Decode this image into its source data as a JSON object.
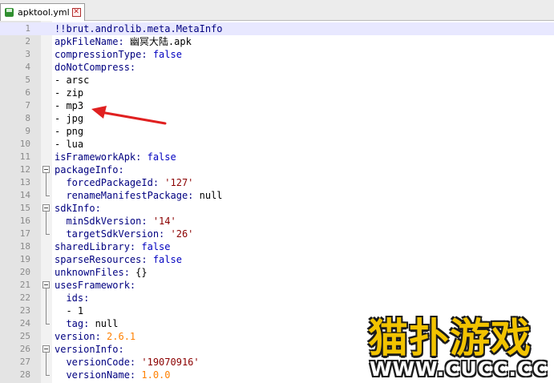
{
  "tab": {
    "filename": "apktool.yml",
    "close_glyph": "✕"
  },
  "lines": [
    {
      "num": "1",
      "tokens": [
        {
          "t": "!!brut.androlib.meta.MetaInfo",
          "c": "k"
        }
      ]
    },
    {
      "num": "2",
      "tokens": [
        {
          "t": "apkFileName: ",
          "c": "k"
        },
        {
          "t": "幽冥大陆.apk",
          "c": ""
        }
      ]
    },
    {
      "num": "3",
      "tokens": [
        {
          "t": "compressionType: ",
          "c": "k"
        },
        {
          "t": "false",
          "c": "v"
        }
      ]
    },
    {
      "num": "4",
      "tokens": [
        {
          "t": "doNotCompress:",
          "c": "k"
        }
      ]
    },
    {
      "num": "5",
      "tokens": [
        {
          "t": "- arsc",
          "c": ""
        }
      ]
    },
    {
      "num": "6",
      "tokens": [
        {
          "t": "- zip",
          "c": ""
        }
      ]
    },
    {
      "num": "7",
      "tokens": [
        {
          "t": "- mp3",
          "c": ""
        }
      ]
    },
    {
      "num": "8",
      "tokens": [
        {
          "t": "- jpg",
          "c": ""
        }
      ]
    },
    {
      "num": "9",
      "tokens": [
        {
          "t": "- png",
          "c": ""
        }
      ]
    },
    {
      "num": "10",
      "tokens": [
        {
          "t": "- lua",
          "c": ""
        }
      ]
    },
    {
      "num": "11",
      "tokens": [
        {
          "t": "isFrameworkApk: ",
          "c": "k"
        },
        {
          "t": "false",
          "c": "v"
        }
      ]
    },
    {
      "num": "12",
      "tokens": [
        {
          "t": "packageInfo:",
          "c": "k"
        }
      ]
    },
    {
      "num": "13",
      "tokens": [
        {
          "t": "  forcedPackageId: ",
          "c": "k"
        },
        {
          "t": "'127'",
          "c": "s"
        }
      ]
    },
    {
      "num": "14",
      "tokens": [
        {
          "t": "  renameManifestPackage: ",
          "c": "k"
        },
        {
          "t": "null",
          "c": ""
        }
      ]
    },
    {
      "num": "15",
      "tokens": [
        {
          "t": "sdkInfo:",
          "c": "k"
        }
      ]
    },
    {
      "num": "16",
      "tokens": [
        {
          "t": "  minSdkVersion: ",
          "c": "k"
        },
        {
          "t": "'14'",
          "c": "s"
        }
      ]
    },
    {
      "num": "17",
      "tokens": [
        {
          "t": "  targetSdkVersion: ",
          "c": "k"
        },
        {
          "t": "'26'",
          "c": "s"
        }
      ]
    },
    {
      "num": "18",
      "tokens": [
        {
          "t": "sharedLibrary: ",
          "c": "k"
        },
        {
          "t": "false",
          "c": "v"
        }
      ]
    },
    {
      "num": "19",
      "tokens": [
        {
          "t": "sparseResources: ",
          "c": "k"
        },
        {
          "t": "false",
          "c": "v"
        }
      ]
    },
    {
      "num": "20",
      "tokens": [
        {
          "t": "unknownFiles: ",
          "c": "k"
        },
        {
          "t": "{}",
          "c": ""
        }
      ]
    },
    {
      "num": "21",
      "tokens": [
        {
          "t": "usesFramework:",
          "c": "k"
        }
      ]
    },
    {
      "num": "22",
      "tokens": [
        {
          "t": "  ids:",
          "c": "k"
        }
      ]
    },
    {
      "num": "23",
      "tokens": [
        {
          "t": "  - 1",
          "c": ""
        }
      ]
    },
    {
      "num": "24",
      "tokens": [
        {
          "t": "  tag: ",
          "c": "k"
        },
        {
          "t": "null",
          "c": ""
        }
      ]
    },
    {
      "num": "25",
      "tokens": [
        {
          "t": "version: ",
          "c": "k"
        },
        {
          "t": "2.6.1",
          "c": "n"
        }
      ]
    },
    {
      "num": "26",
      "tokens": [
        {
          "t": "versionInfo:",
          "c": "k"
        }
      ]
    },
    {
      "num": "27",
      "tokens": [
        {
          "t": "  versionCode: ",
          "c": "k"
        },
        {
          "t": "'19070916'",
          "c": "s"
        }
      ]
    },
    {
      "num": "28",
      "tokens": [
        {
          "t": "  versionName: ",
          "c": "k"
        },
        {
          "t": "1.0.0",
          "c": "n"
        }
      ]
    }
  ],
  "watermark": {
    "title": "猫扑游戏",
    "url": "WWW.CUCC.CC"
  },
  "colors": {
    "arrow": "#e02020",
    "keyword": "#000080",
    "boolean": "#0000c0",
    "string": "#8b0000",
    "number": "#ff8000"
  }
}
